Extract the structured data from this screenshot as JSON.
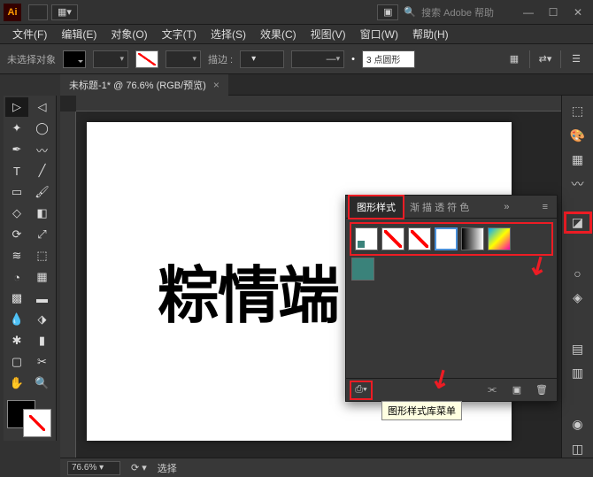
{
  "titlebar": {
    "app": "Ai",
    "search_placeholder": "搜索 Adobe 帮助"
  },
  "menu": {
    "file": "文件(F)",
    "edit": "编辑(E)",
    "object": "对象(O)",
    "type": "文字(T)",
    "select": "选择(S)",
    "effect": "效果(C)",
    "view": "视图(V)",
    "window": "窗口(W)",
    "help": "帮助(H)"
  },
  "options": {
    "no_sel": "未选择对象",
    "stroke_label": "描边 :",
    "stroke_width": "",
    "pt": "",
    "profile": "3 点圆形"
  },
  "doctab": {
    "title": "未标题-1* @ 76.6% (RGB/预览)",
    "close": "×"
  },
  "canvas": {
    "text": "粽情端"
  },
  "panel": {
    "tab_styles": "图形样式",
    "tab_other": "渐 描 透 符 色",
    "collapse": "»",
    "menu": "≡",
    "tooltip": "图形样式库菜单",
    "lib_btn": "⎙▾"
  },
  "status": {
    "zoom": "76.6%",
    "sel": "选择"
  }
}
